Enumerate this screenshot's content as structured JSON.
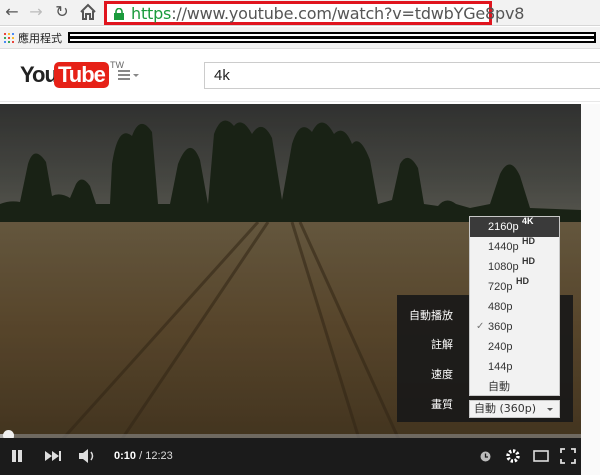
{
  "browser": {
    "url_https": "https",
    "url_rest": "://www.youtube.com/watch?v=tdwbYGe8pv8",
    "bookmarks_label": "應用程式"
  },
  "header": {
    "logo_you": "You",
    "logo_tube": "Tube",
    "logo_region": "TW",
    "search_value": "4k"
  },
  "quality_menu": {
    "items": [
      {
        "label": "2160p",
        "badge": "4K",
        "active": true
      },
      {
        "label": "1440p",
        "badge": "HD"
      },
      {
        "label": "1080p",
        "badge": "HD"
      },
      {
        "label": "720p",
        "badge": "HD"
      },
      {
        "label": "480p"
      },
      {
        "label": "360p",
        "checked": true
      },
      {
        "label": "240p"
      },
      {
        "label": "144p"
      },
      {
        "label": "自動"
      }
    ]
  },
  "settings": {
    "autoplay_label": "自動播放",
    "annotations_label": "註解",
    "speed_label": "速度",
    "quality_label": "畫質",
    "quality_value": "自動 (360p)"
  },
  "player": {
    "current_time": "0:10",
    "separator": " / ",
    "duration": "12:23",
    "progress_fraction": 0.013
  }
}
